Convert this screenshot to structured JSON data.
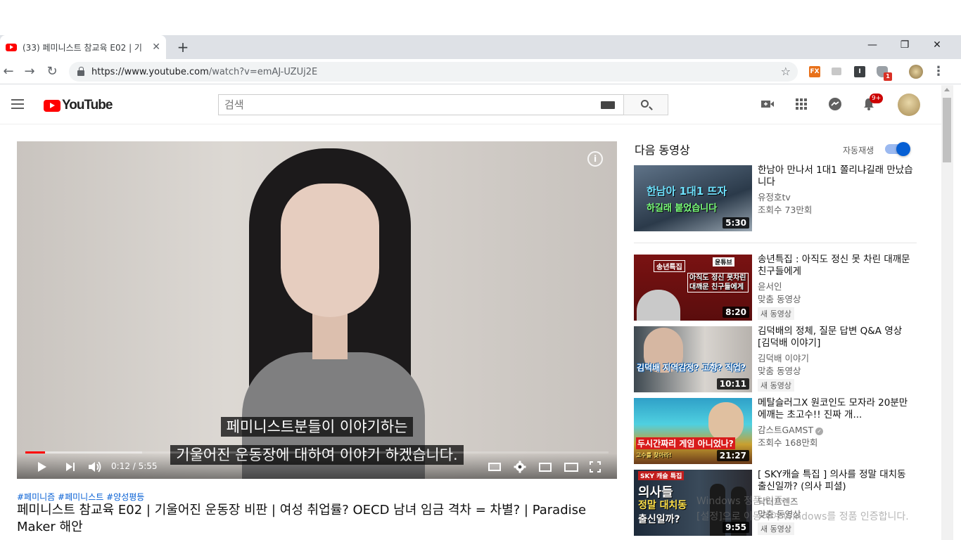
{
  "browser": {
    "tab_title": "(33) 페미니스트 참교육 E02 | 기",
    "tab_close": "✕",
    "new_tab": "+",
    "window_minimize": "—",
    "window_restore": "❐",
    "window_close": "✕",
    "url_host": "https://www.youtube.com",
    "url_path": "/watch?v=emAJ-UZUj2E",
    "extension_badge": "1",
    "extensions": [
      "FX",
      "I"
    ]
  },
  "youtube": {
    "logo_text": "YouTube",
    "search_placeholder": "검색",
    "notification_count": "9+"
  },
  "player": {
    "subtitle_line1": "페미니스트분들이 이야기하는",
    "subtitle_line2": "기울어진 운동장에 대하여 이야기 하겠습니다.",
    "time": "0:12 / 5:55",
    "progress_fraction": 0.034,
    "buffered_fraction": 0.2,
    "info_label": "i"
  },
  "video": {
    "hashtags": "#페미니즘 #페미니스트 #양성평등",
    "title": "페미니스트 참교육 E02 | 기울어진 운동장 비판 | 여성 취업률? OECD 남녀 임금 격차 = 차별? | Paradise Maker 해안"
  },
  "sidebar": {
    "up_next": "다음 동영상",
    "autoplay": "자동재생",
    "autoplay_on": true,
    "items": [
      {
        "title": "한남아 만나서 1대1 쫄리냐길래 만났습니다",
        "channel": "유정호tv",
        "views": "조회수 73만회",
        "badge": "",
        "duration": "5:30",
        "thumb_text1": "한남아 1대1 뜨자",
        "thumb_text2": "하길래 붙었습니다"
      },
      {
        "title": "송년특집 : 아직도 정신 못 차린 대깨문 친구들에게",
        "channel": "윤서인",
        "views": "맞춤 동영상",
        "badge": "새 동영상",
        "duration": "8:20",
        "thumb_text1": "송년특집",
        "thumb_text2": "아직도 정신 못차린",
        "thumb_text3": "대깨문 친구들에게",
        "thumb_text4": "윤튜브"
      },
      {
        "title": "김덕배의 정체, 질문 답변 Q&A 영상 [김덕배 이야기]",
        "channel": "김덕배 이야기",
        "views": "맞춤 동영상",
        "badge": "새 동영상",
        "duration": "10:11",
        "thumb_text1": "김덕배 지역감정? 고향? 직업?"
      },
      {
        "title": "메탈슬러그X 원코인도 모자라 20분만에깨는 초고수!! 진짜 개...",
        "channel": "감스트GAMST",
        "views": "조회수 168만회",
        "badge": "",
        "duration": "21:27",
        "thumb_text1": "두시간짜리 게임 아니었나?",
        "thumb_text2": "고수를 찾아라!"
      },
      {
        "title": "[ SKY캐슬 특집 ] 의사를 정말 대치동 출신일까? (의사 피셜)",
        "channel": "닥터프렌즈",
        "views": "맞춤 동영상",
        "badge": "새 동영상",
        "duration": "9:55",
        "thumb_text1": "SKY 캐슬 특집",
        "thumb_text2": "의사들",
        "thumb_text3": "정말 대치동",
        "thumb_text4": "출신일까?"
      }
    ]
  },
  "watermark": {
    "line1": "Windows 정품 인증",
    "line2": "[설정]으로 이동하여 Windows를 정품 인증합니다."
  },
  "colors": {
    "youtube_red": "#ff0000",
    "link_blue": "#065fd4",
    "notification_red": "#cc0000"
  }
}
